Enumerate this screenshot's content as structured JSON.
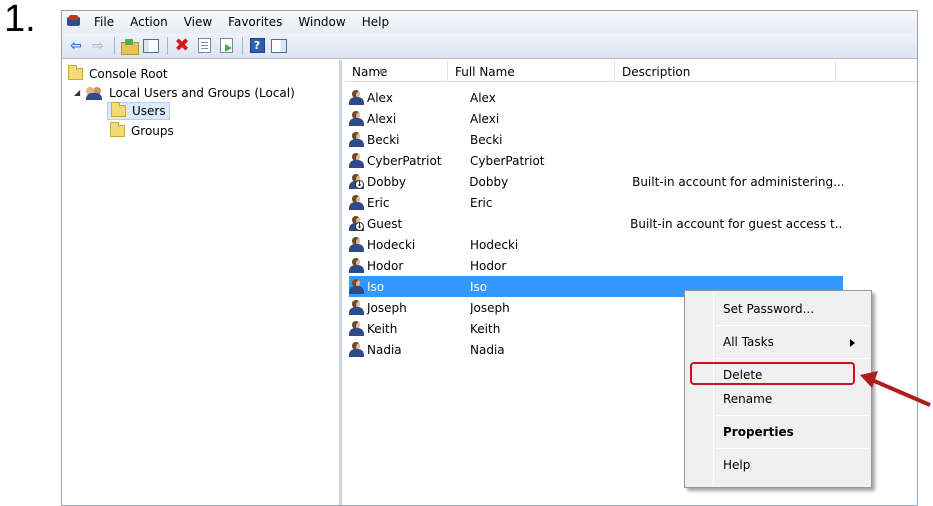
{
  "step_label": "1.",
  "menubar": {
    "items": [
      "File",
      "Action",
      "View",
      "Favorites",
      "Window",
      "Help"
    ]
  },
  "toolbar": {
    "buttons": [
      "back-icon",
      "forward-icon",
      "up-folder-icon",
      "show-hide-tree-icon",
      "delete-icon",
      "properties-icon",
      "export-list-icon",
      "help-icon",
      "show-action-pane-icon"
    ]
  },
  "tree": {
    "root": "Console Root",
    "node": "Local Users and Groups (Local)",
    "children": [
      "Users",
      "Groups"
    ],
    "selected": "Users"
  },
  "list": {
    "columns": [
      "Name",
      "Full Name",
      "Description"
    ],
    "rows": [
      {
        "name": "Alex",
        "full_name": "Alex",
        "description": ""
      },
      {
        "name": "Alexi",
        "full_name": "Alexi",
        "description": ""
      },
      {
        "name": "Becki",
        "full_name": "Becki",
        "description": ""
      },
      {
        "name": "CyberPatriot",
        "full_name": "CyberPatriot",
        "description": ""
      },
      {
        "name": "Dobby",
        "full_name": "Dobby",
        "description": "Built-in account for administering..."
      },
      {
        "name": "Eric",
        "full_name": "Eric",
        "description": ""
      },
      {
        "name": "Guest",
        "full_name": "",
        "description": "Built-in account for guest access t..."
      },
      {
        "name": "Hodecki",
        "full_name": "Hodecki",
        "description": ""
      },
      {
        "name": "Hodor",
        "full_name": "Hodor",
        "description": ""
      },
      {
        "name": "Iso",
        "full_name": "Iso",
        "description": ""
      },
      {
        "name": "Joseph",
        "full_name": "Joseph",
        "description": ""
      },
      {
        "name": "Keith",
        "full_name": "Keith",
        "description": ""
      },
      {
        "name": "Nadia",
        "full_name": "Nadia",
        "description": ""
      }
    ],
    "selected_row": "Iso"
  },
  "context_menu": {
    "set_password": "Set Password...",
    "all_tasks": "All Tasks",
    "delete": "Delete",
    "rename": "Rename",
    "properties": "Properties",
    "help": "Help"
  },
  "colors": {
    "selection": "#3399ff",
    "highlight": "#c0151b",
    "arrow": "#b01c1c"
  }
}
